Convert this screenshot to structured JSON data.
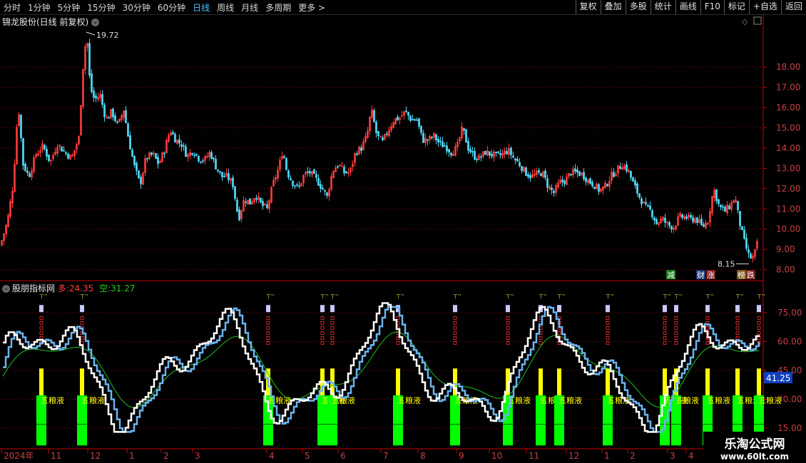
{
  "toolbar": {
    "periods": [
      "分时",
      "1分钟",
      "5分钟",
      "15分钟",
      "30分钟",
      "60分钟",
      "日线",
      "周线",
      "月线",
      "多周期",
      "更多 >"
    ],
    "active_period": "日线",
    "actions": [
      "复权",
      "叠加",
      "多股",
      "统计",
      "画线",
      "F10",
      "标记",
      "+自选",
      "返回"
    ]
  },
  "main_chart": {
    "title": "锦龙股份(日线 前复权)",
    "high_label": "19.72",
    "low_label": "8.15",
    "tags": [
      "减",
      "财",
      "涨",
      "榜",
      "跌"
    ]
  },
  "indicator": {
    "name": "股朋指标网",
    "long_label": "多:",
    "long_value": "24.35",
    "short_label": "空:",
    "short_value": "31.27",
    "current_value_tag": "41.25",
    "signal_text": "五粮液"
  },
  "watermark": {
    "line1": "乐淘公式网",
    "line2": "www.60lt.com"
  },
  "colors": {
    "up": "#ff3c3c",
    "down": "#4fd4f0",
    "white_line": "#ffffff",
    "blue_line": "#6ab4f0",
    "green_line": "#20c020",
    "yellow": "#ffff00",
    "green_bar": "#00ff00",
    "axis": "#c80000"
  },
  "chart_data": [
    {
      "type": "candlestick",
      "title": "锦龙股份(日线 前复权)",
      "y_ticks": [
        8.0,
        9.0,
        10.0,
        11.0,
        12.0,
        13.0,
        14.0,
        15.0,
        16.0,
        17.0,
        18.0
      ],
      "ylim": [
        7.6,
        19.9
      ],
      "x_ticks": [
        "2024年",
        "11",
        "12",
        "1",
        "2",
        "3",
        "4",
        "5",
        "6",
        "7",
        "8",
        "9",
        "10",
        "11",
        "12",
        "1",
        "2",
        "3",
        "4"
      ],
      "max": 19.72,
      "min": 8.15,
      "close_path": [
        [
          0,
          9.2
        ],
        [
          10,
          10.4
        ],
        [
          18,
          12.2
        ],
        [
          25,
          16.2
        ],
        [
          32,
          13.2
        ],
        [
          40,
          12.6
        ],
        [
          50,
          13.7
        ],
        [
          60,
          14.1
        ],
        [
          70,
          13.3
        ],
        [
          80,
          14.2
        ],
        [
          90,
          13.8
        ],
        [
          100,
          13.5
        ],
        [
          110,
          14.5
        ],
        [
          116,
          18.0
        ],
        [
          121,
          19.7
        ],
        [
          126,
          17.0
        ],
        [
          132,
          16.4
        ],
        [
          140,
          16.6
        ],
        [
          148,
          15.4
        ],
        [
          156,
          15.8
        ],
        [
          165,
          15.1
        ],
        [
          173,
          15.9
        ],
        [
          180,
          14.4
        ],
        [
          188,
          13.1
        ],
        [
          196,
          12.2
        ],
        [
          204,
          13.5
        ],
        [
          214,
          13.7
        ],
        [
          222,
          13.2
        ],
        [
          230,
          13.9
        ],
        [
          238,
          14.9
        ],
        [
          246,
          14.4
        ],
        [
          254,
          14.2
        ],
        [
          262,
          13.6
        ],
        [
          270,
          13.9
        ],
        [
          278,
          13.5
        ],
        [
          286,
          13.4
        ],
        [
          294,
          13.8
        ],
        [
          302,
          13.1
        ],
        [
          310,
          12.6
        ],
        [
          318,
          12.6
        ],
        [
          326,
          12.2
        ],
        [
          334,
          10.5
        ],
        [
          342,
          11.5
        ],
        [
          350,
          11.3
        ],
        [
          358,
          11.7
        ],
        [
          366,
          11.2
        ],
        [
          374,
          11.0
        ],
        [
          382,
          12.2
        ],
        [
          390,
          13.0
        ],
        [
          396,
          13.9
        ],
        [
          402,
          12.8
        ],
        [
          410,
          12.3
        ],
        [
          418,
          12.0
        ],
        [
          426,
          12.7
        ],
        [
          434,
          12.8
        ],
        [
          442,
          12.5
        ],
        [
          450,
          12.1
        ],
        [
          458,
          11.6
        ],
        [
          466,
          12.9
        ],
        [
          474,
          13.2
        ],
        [
          482,
          12.8
        ],
        [
          490,
          12.8
        ],
        [
          498,
          13.8
        ],
        [
          506,
          14.0
        ],
        [
          514,
          14.6
        ],
        [
          520,
          15.9
        ],
        [
          528,
          14.6
        ],
        [
          536,
          14.3
        ],
        [
          544,
          14.9
        ],
        [
          552,
          15.4
        ],
        [
          560,
          15.5
        ],
        [
          568,
          15.8
        ],
        [
          576,
          15.4
        ],
        [
          584,
          15.4
        ],
        [
          592,
          14.4
        ],
        [
          600,
          14.4
        ],
        [
          608,
          14.6
        ],
        [
          616,
          14.2
        ],
        [
          624,
          14.1
        ],
        [
          632,
          13.8
        ],
        [
          640,
          14.0
        ],
        [
          648,
          15.0
        ],
        [
          656,
          14.0
        ],
        [
          664,
          13.6
        ],
        [
          672,
          13.5
        ],
        [
          680,
          13.8
        ],
        [
          688,
          13.7
        ],
        [
          696,
          13.6
        ],
        [
          704,
          13.7
        ],
        [
          712,
          13.9
        ],
        [
          720,
          13.5
        ],
        [
          728,
          13.2
        ],
        [
          736,
          12.8
        ],
        [
          744,
          12.6
        ],
        [
          752,
          12.7
        ],
        [
          760,
          12.8
        ],
        [
          768,
          12.1
        ],
        [
          776,
          11.8
        ],
        [
          784,
          12.3
        ],
        [
          792,
          12.4
        ],
        [
          800,
          12.8
        ],
        [
          808,
          12.8
        ],
        [
          816,
          12.7
        ],
        [
          824,
          12.4
        ],
        [
          832,
          12.2
        ],
        [
          840,
          11.9
        ],
        [
          848,
          12.1
        ],
        [
          856,
          12.6
        ],
        [
          864,
          12.9
        ],
        [
          872,
          13.2
        ],
        [
          880,
          12.9
        ],
        [
          888,
          12.2
        ],
        [
          896,
          11.6
        ],
        [
          904,
          11.1
        ],
        [
          912,
          10.9
        ],
        [
          920,
          10.3
        ],
        [
          928,
          10.5
        ],
        [
          936,
          10.2
        ],
        [
          944,
          10.1
        ],
        [
          952,
          10.6
        ],
        [
          960,
          10.6
        ],
        [
          968,
          10.5
        ],
        [
          976,
          10.5
        ],
        [
          984,
          10.1
        ],
        [
          992,
          10.4
        ],
        [
          1000,
          12.0
        ],
        [
          1008,
          11.1
        ],
        [
          1016,
          10.9
        ],
        [
          1024,
          11.2
        ],
        [
          1030,
          11.6
        ],
        [
          1036,
          10.4
        ],
        [
          1042,
          9.5
        ],
        [
          1050,
          8.6
        ],
        [
          1056,
          8.6
        ],
        [
          1062,
          9.4
        ]
      ]
    },
    {
      "type": "line",
      "title": "股朋指标网",
      "y_ticks": [
        15.0,
        30.0,
        45.0,
        60.0,
        75.0
      ],
      "series": [
        {
          "name": "多",
          "values_last": 24.35
        },
        {
          "name": "空",
          "values_last": 31.27
        }
      ],
      "current_tag": 41.25,
      "signal_x": [
        58,
        115,
        376,
        452,
        466,
        558,
        638,
        712,
        758,
        784,
        852,
        932,
        948,
        992,
        1034,
        1064
      ]
    }
  ]
}
